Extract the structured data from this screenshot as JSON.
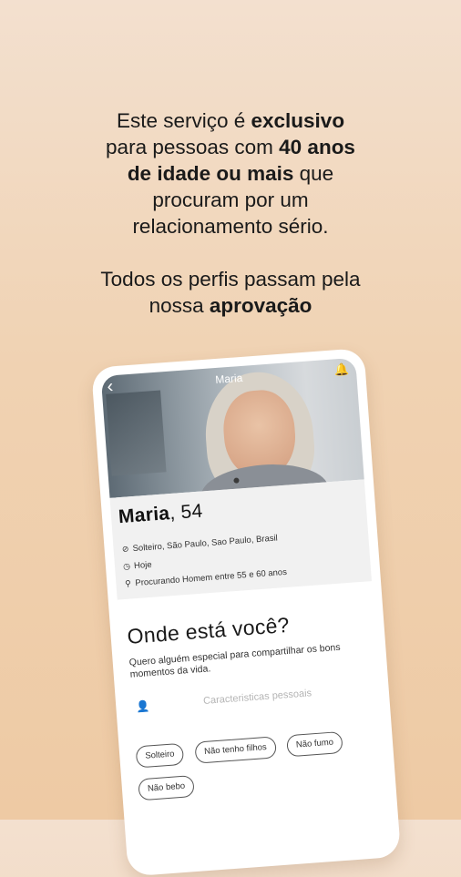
{
  "headline": {
    "p1_l1_a": "Este serviço é ",
    "p1_l1_b": "exclusivo",
    "p1_l2_a": "para pessoas com ",
    "p1_l2_b": "40 anos",
    "p1_l3_a": "de idade ou mais",
    "p1_l3_b": " que",
    "p1_l4": "procuram por um",
    "p1_l5": "relacionamento sério.",
    "p2_l1": "Todos os perfis passam pela",
    "p2_l2_a": "nossa ",
    "p2_l2_b": "aprovação"
  },
  "profile": {
    "header_name": "Maria",
    "name": "Maria",
    "age": ", 54",
    "status": "Solteiro, São Paulo, Sao Paulo, Brasil",
    "last_seen": "Hoje",
    "looking_for": "Procurando Homem entre 55 e 60 anos"
  },
  "about": {
    "title": "Onde está você?",
    "description": "Quero alguém especial para compartilhar os bons momentos da vida.",
    "characteristics_placeholder": "Caracteristicas pessoais",
    "chips": [
      "Solteiro",
      "Não tenho filhos",
      "Não fumo",
      "Não bebo"
    ]
  },
  "icons": {
    "back": "chevron-left-icon",
    "notification": "bell-icon",
    "status": "compass-icon",
    "time": "clock-icon",
    "search": "search-icon",
    "user": "user-icon"
  }
}
